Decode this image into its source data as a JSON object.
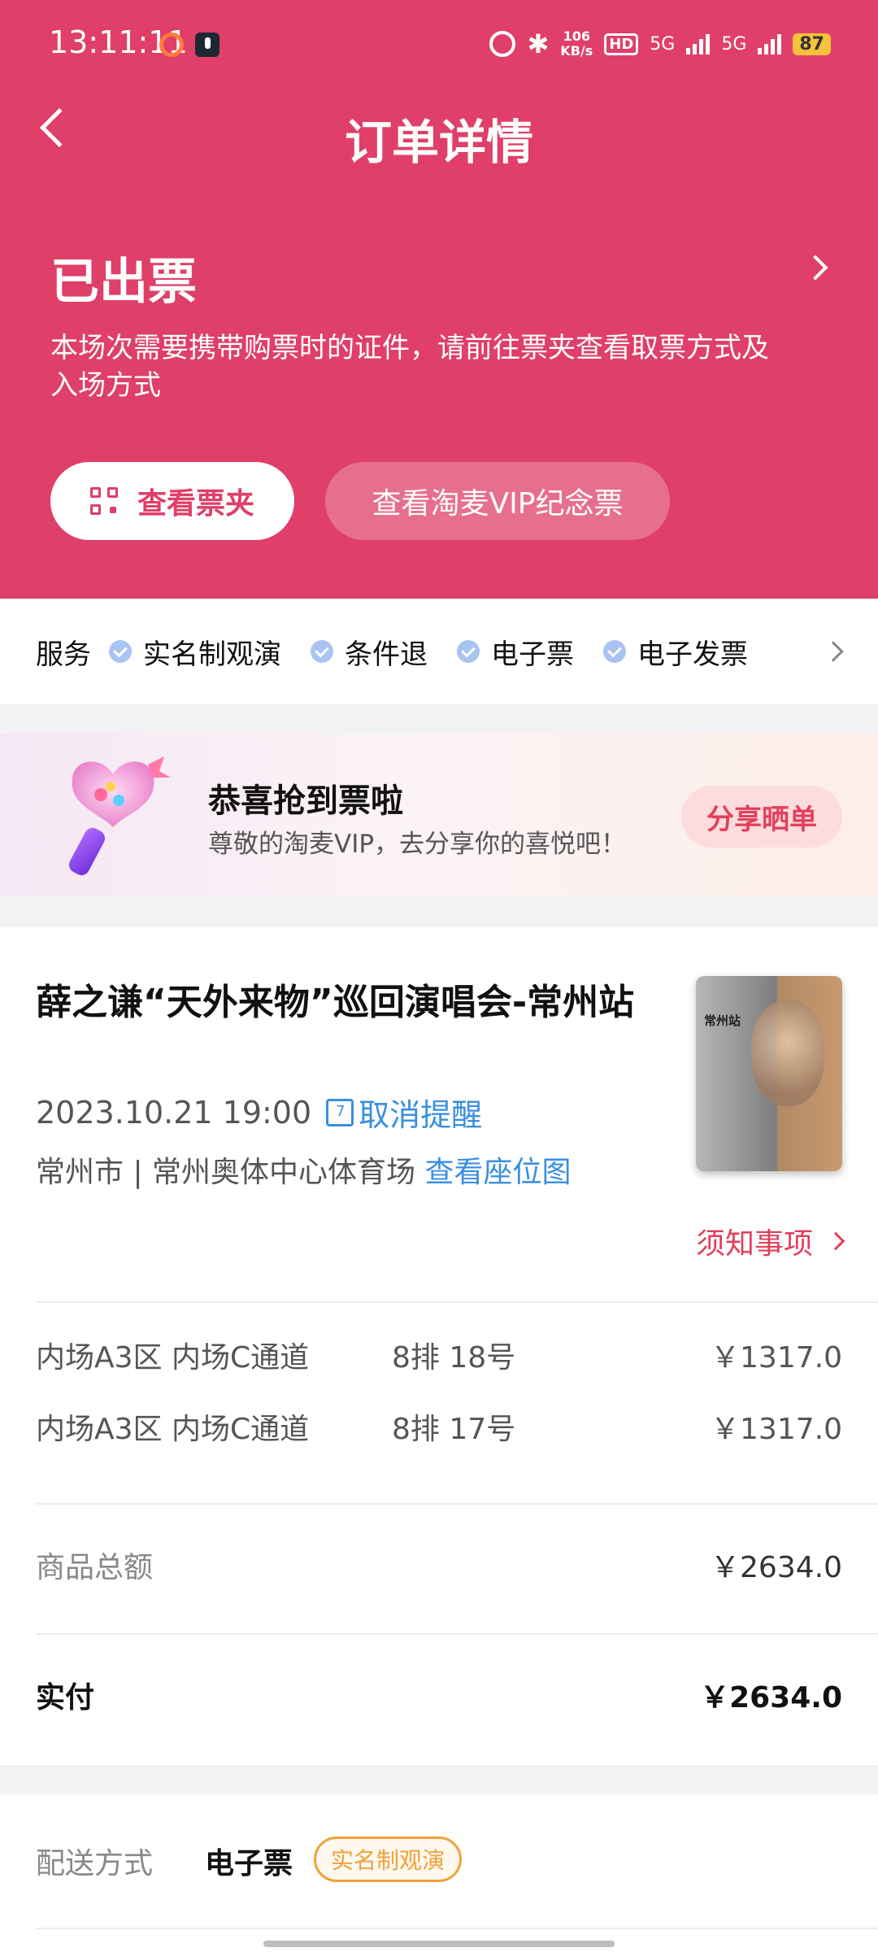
{
  "status_bar": {
    "time": "13:11:11",
    "speed_value": "106",
    "speed_unit": "KB/s",
    "hd_label": "HD",
    "net1": "5G",
    "net2": "5G",
    "battery": "87"
  },
  "nav": {
    "title": "订单详情"
  },
  "order_state": {
    "title": "已出票",
    "notice": "本场次需要携带购票时的证件，请前往票夹查看取票方式及入场方式",
    "wallet_button": "查看票夹",
    "vip_button": "查看淘麦VIP纪念票"
  },
  "services": {
    "label": "服务",
    "items": [
      "实名制观演",
      "条件退",
      "电子票",
      "电子发票"
    ]
  },
  "banner": {
    "headline": "恭喜抢到票啦",
    "subtext": "尊敬的淘麦VIP，去分享你的喜悦吧！",
    "share_button": "分享晒单"
  },
  "event": {
    "title": "薛之谦“天外来物”巡回演唱会-常州站",
    "datetime": "2023.10.21 19:00",
    "cancel_reminder": "取消提醒",
    "venue": "常州市 | 常州奥体中心体育场",
    "seat_map_link": "查看座位图",
    "notes_link": "须知事项",
    "poster_label": "常州站"
  },
  "tickets": [
    {
      "zone": "内场A3区 内场C通道",
      "seat": "8排 18号",
      "price": "￥1317.0"
    },
    {
      "zone": "内场A3区 内场C通道",
      "seat": "8排 17号",
      "price": "￥1317.0"
    }
  ],
  "summary": {
    "subtotal_label": "商品总额",
    "subtotal_value": "￥2634.0",
    "paid_label": "实付",
    "paid_value": "￥2634.0"
  },
  "delivery": {
    "label": "配送方式",
    "value": "电子票",
    "tag": "实名制观演"
  },
  "colors": {
    "brand": "#df3f69",
    "link": "#3a8fe0",
    "accent_red": "#e3405c",
    "tag_orange": "#f0a13a"
  }
}
